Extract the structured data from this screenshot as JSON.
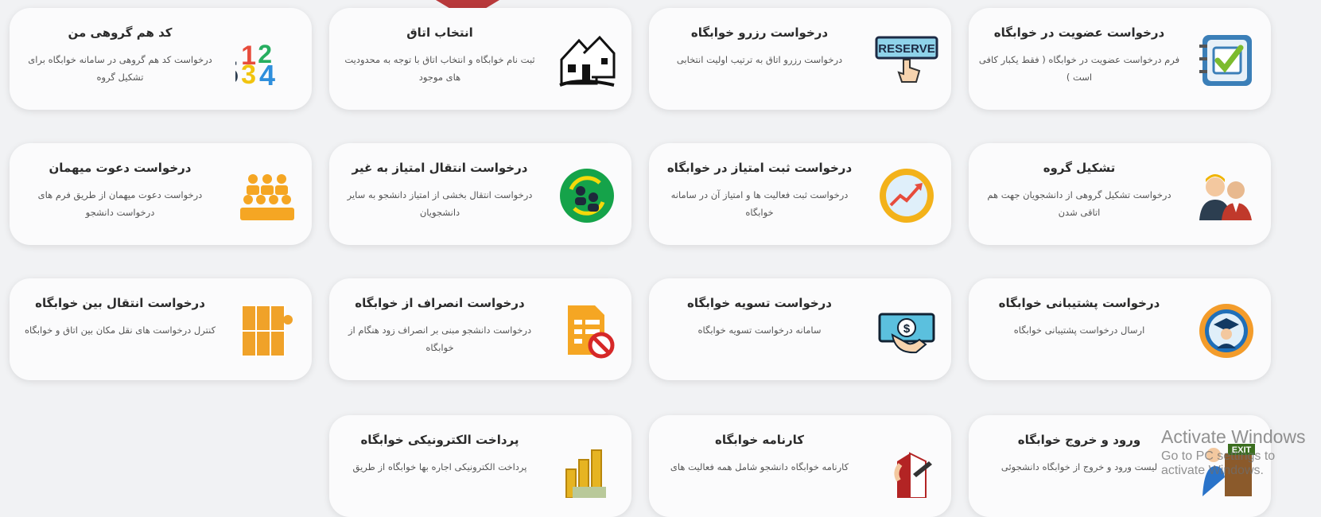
{
  "cards": [
    {
      "title": "درخواست عضویت در خوابگاه",
      "desc": "فرم درخواست عضویت در خوابگاه ( فقط یکبار کافی است )",
      "icon": "form-check-icon"
    },
    {
      "title": "درخواست رزرو خوابگاه",
      "desc": "درخواست رزرو اتاق به ترتیب اولیت انتخابی",
      "icon": "reserve-button-icon",
      "icon_text": "RESERVE"
    },
    {
      "title": "انتخاب اتاق",
      "desc": "ثبت نام خوابگاه و انتخاب اتاق با توجه به محدودیت های موجود",
      "icon": "houses-icon"
    },
    {
      "title": "کد هم گروهی من",
      "desc": "درخواست کد هم گروهی در سامانه خوابگاه برای تشکیل گروه",
      "icon": "numbers-icon",
      "icon_text": "1234"
    },
    {
      "title": "تشکیل گروه",
      "desc": "درخواست تشکیل گروهی از دانشجویان جهت هم اتاقی شدن",
      "icon": "group-people-icon"
    },
    {
      "title": "درخواست ثبت امتیاز در خوابگاه",
      "desc": "درخواست ثبت فعالیت ها و امتیاز آن در سامانه خوابگاه",
      "icon": "growth-chart-icon"
    },
    {
      "title": "درخواست انتقال امتیاز به غیر",
      "desc": "درخواست انتقال بخشی از امتیاز دانشجو به سایر دانشجویان",
      "icon": "transfer-users-icon"
    },
    {
      "title": "درخواست دعوت میهمان",
      "desc": "درخواست دعوت میهمان از طریق فرم های درخواست دانشجو",
      "icon": "guests-icon"
    },
    {
      "title": "درخواست پشتیبانی خوابگاه",
      "desc": "ارسال درخواست پشتیبانی خوابگاه",
      "icon": "graduate-support-icon"
    },
    {
      "title": "درخواست تسویه خوابگاه",
      "desc": "سامانه درخواست تسویه خوابگاه",
      "icon": "money-hand-icon"
    },
    {
      "title": "درخواست انصراف از خوابگاه",
      "desc": "درخواست دانشجو مبنی بر انصراف زود هنگام از خوابگاه",
      "icon": "cancel-document-icon"
    },
    {
      "title": "درخواست انتقال بین خوابگاه",
      "desc": "کنترل درخواست های نقل مکان بین اتاق و خوابگاه",
      "icon": "lockers-key-icon"
    },
    {
      "title": "ورود و خروج خوابگاه",
      "desc": "لیست ورود و خروج از خوابگاه دانشجوئی",
      "icon": "exit-door-icon",
      "icon_text": "EXIT"
    },
    {
      "title": "کارنامه خوابگاه",
      "desc": "کارنامه خوابگاه دانشجو شامل همه فعالیت های",
      "icon": "report-book-icon"
    },
    {
      "title": "پرداخت الکترونیکی خوابگاه",
      "desc": "پرداخت الکترونیکی اجاره بها خوابگاه از طریق",
      "icon": "coins-money-icon"
    }
  ],
  "watermark": {
    "line1": "Activate Windows",
    "line2": "Go to PC settings to activate Windows."
  },
  "colors": {
    "pointer": "#b8393b",
    "card_bg": "#fbfbfc",
    "page_bg": "#f1f2f4"
  }
}
